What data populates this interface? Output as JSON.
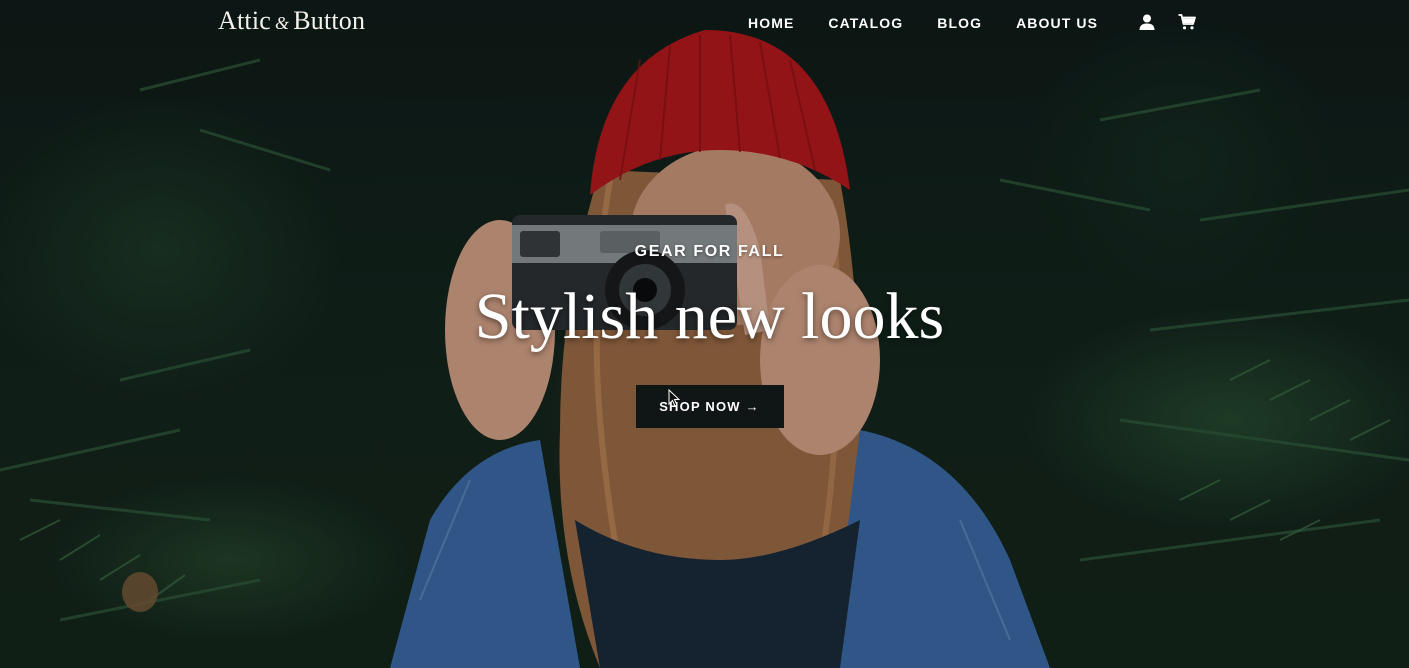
{
  "header": {
    "logo_main": "Attic",
    "logo_amp": "&",
    "logo_end": "Button",
    "nav": [
      {
        "label": "HOME"
      },
      {
        "label": "CATALOG"
      },
      {
        "label": "BLOG"
      },
      {
        "label": "ABOUT US"
      }
    ],
    "icons": [
      "account-icon",
      "cart-icon"
    ]
  },
  "hero": {
    "eyebrow": "GEAR FOR FALL",
    "headline": "Stylish new looks",
    "cta_label": "SHOP NOW →",
    "image_subject": "woman in red beanie and denim jacket holding a film camera in front of evergreen branches"
  },
  "colors": {
    "hero_bg": "#13241d",
    "button_bg": "#101515",
    "beanie": "#b3191c",
    "denim": "#3b6aa6",
    "text": "#ffffff"
  }
}
